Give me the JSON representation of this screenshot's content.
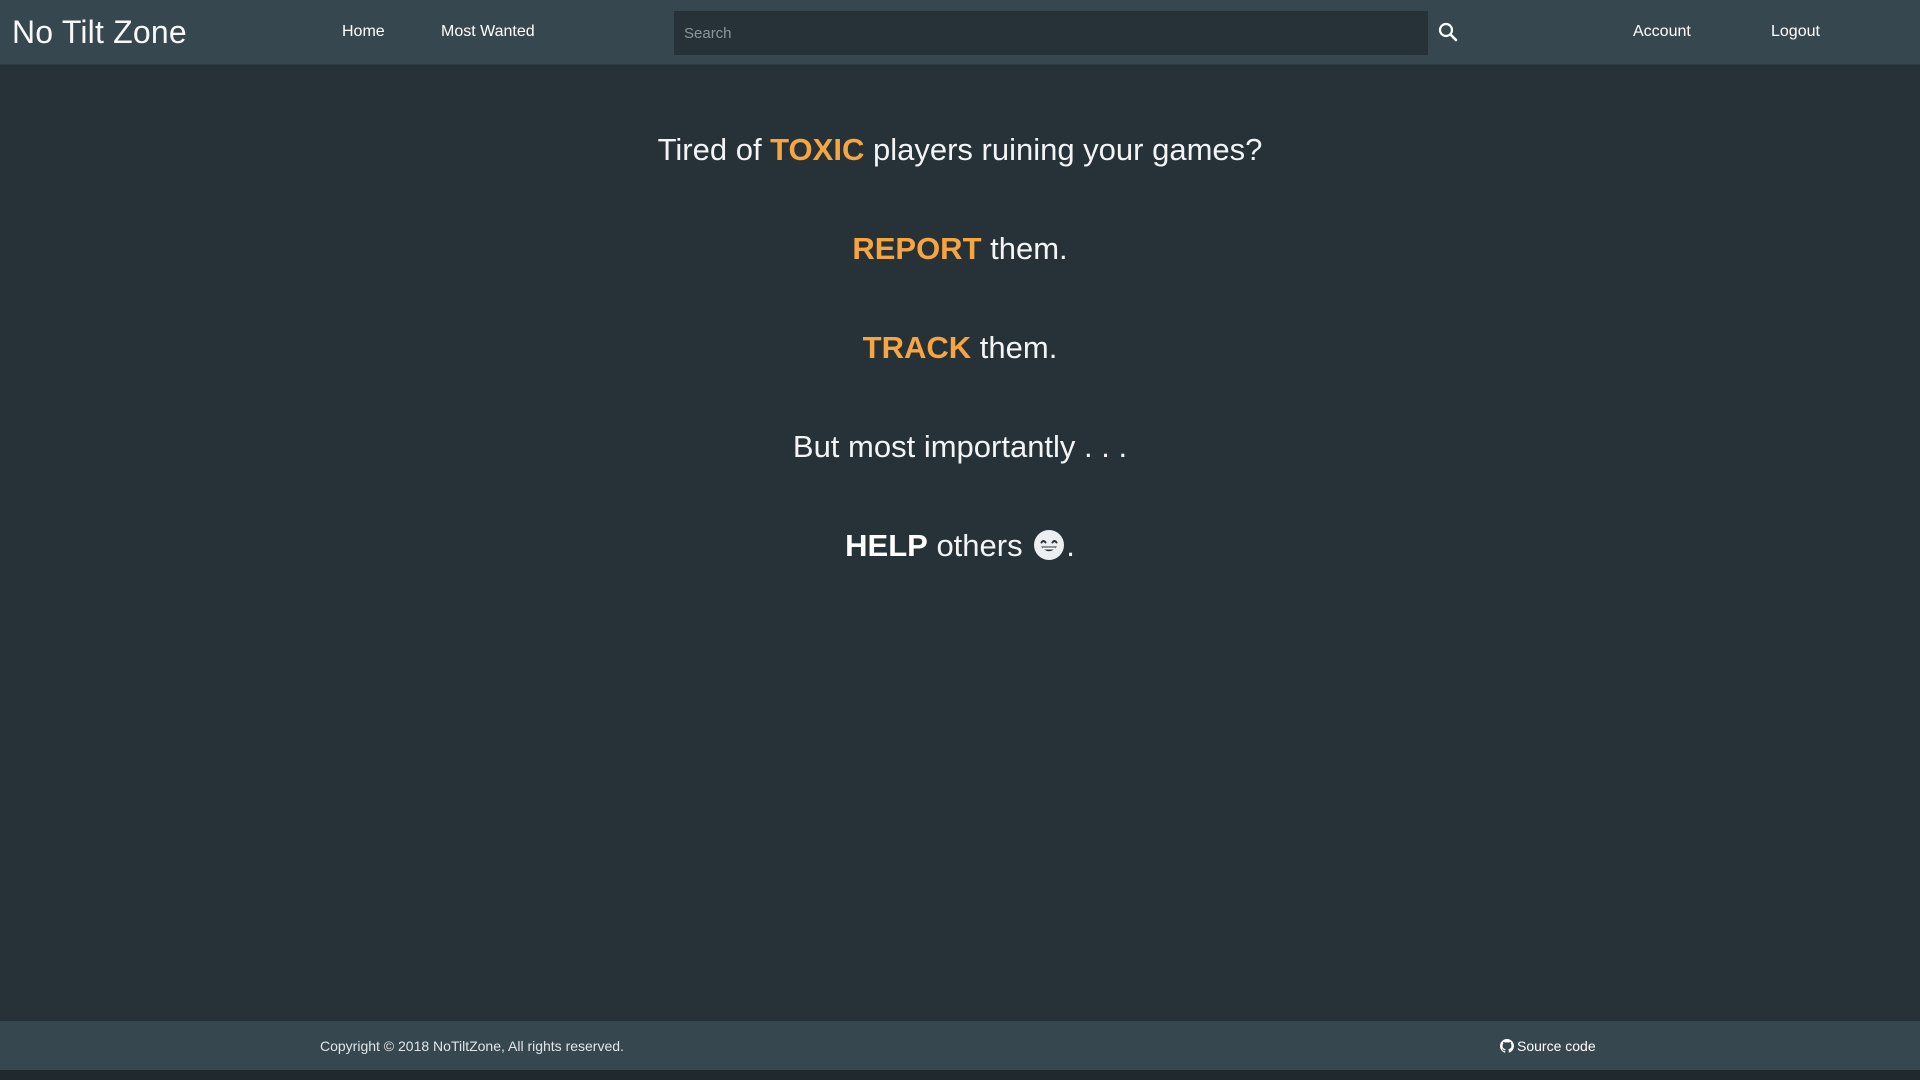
{
  "navbar": {
    "brand": "No Tilt Zone",
    "links": {
      "home": "Home",
      "most_wanted": "Most Wanted",
      "account": "Account",
      "logout": "Logout"
    },
    "search": {
      "placeholder": "Search",
      "value": "",
      "icon": "search-icon"
    }
  },
  "hero": {
    "line1": {
      "pre": "Tired of ",
      "highlight": "TOXIC",
      "post": " players ruining your games?"
    },
    "line2": {
      "highlight": "REPORT",
      "post": " them."
    },
    "line3": {
      "highlight": "TRACK",
      "post": " them."
    },
    "line4": {
      "text": "But most importantly . . ."
    },
    "line5": {
      "bold": "HELP",
      "post": " others ",
      "end": ".",
      "emoji": "grinning-face-icon"
    }
  },
  "footer": {
    "copyright": "Copyright © 2018 NoTiltZone, All rights reserved.",
    "source_label": "Source code",
    "source_icon": "github-icon"
  },
  "colors": {
    "background": "#263238",
    "navbar": "#37474f",
    "accent": "#f6a540",
    "text": "#f2f4f5"
  }
}
